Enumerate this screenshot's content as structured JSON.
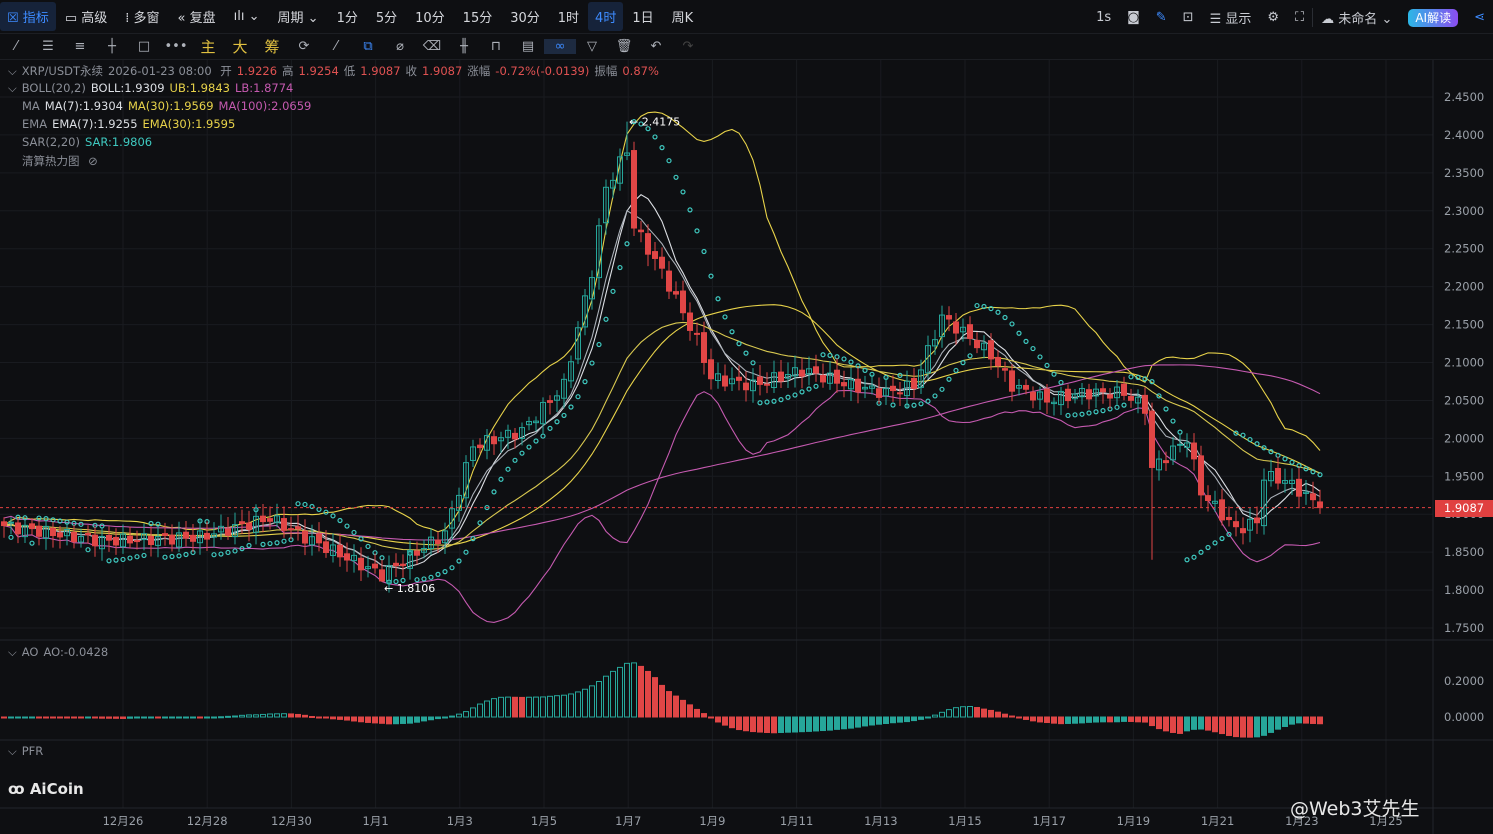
{
  "toolbar": {
    "items": [
      "指标",
      "高级",
      "多窗",
      "复盘",
      "周期",
      "1分",
      "5分",
      "10分",
      "15分",
      "30分",
      "1时",
      "4时",
      "1日",
      "周K"
    ],
    "active": "4时",
    "right": [
      "1s",
      "显示",
      "未命名",
      "AI解读"
    ]
  },
  "drawbar": {
    "labels": [
      "主",
      "大",
      "筹"
    ]
  },
  "legend": {
    "symbol": "XRP/USDT永续",
    "time": "2026-01-23 08:00",
    "open_l": "开",
    "open": "1.9226",
    "high_l": "高",
    "high": "1.9254",
    "low_l": "低",
    "low": "1.9087",
    "close_l": "收",
    "close": "1.9087",
    "chg_l": "涨幅",
    "chg": "-0.72%(-0.0139)",
    "amp_l": "振幅",
    "amp": "0.87%",
    "boll": "BOLL(20,2)",
    "boll_v": "BOLL:1.9309",
    "ub": "UB:1.9843",
    "lb": "LB:1.8774",
    "ma": "MA",
    "ma7": "MA(7):1.9304",
    "ma30": "MA(30):1.9569",
    "ma100": "MA(100):2.0659",
    "ema": "EMA",
    "ema7": "EMA(7):1.9255",
    "ema30": "EMA(30):1.9595",
    "sar": "SAR(2,20)",
    "sar_v": "SAR:1.9806",
    "heat": "清算热力图",
    "ao": "AO",
    "ao_v": "AO:-0.0428",
    "pfr": "PFR"
  },
  "last_price": "1.9087",
  "watermark": "@Web3艾先生",
  "brand": "AiCoin",
  "colors": {
    "up": "#26a69a",
    "down": "#e04646",
    "ma7": "#dcdfe4",
    "ma30": "#e8d34a",
    "ma100": "#c55ab0",
    "sar": "#3fc9c0"
  },
  "chart_data": {
    "type": "candlestick",
    "interval": "4h",
    "yticks": [
      "2.4500",
      "2.4000",
      "2.3500",
      "2.3000",
      "2.2500",
      "2.2000",
      "2.1500",
      "2.1000",
      "2.0500",
      "2.0000",
      "1.9500",
      "1.9000",
      "1.8500",
      "1.8000",
      "1.7500"
    ],
    "ylim": [
      1.75,
      2.45
    ],
    "ao_ticks": [
      "0.2000",
      "0.0000"
    ],
    "xticks": [
      "12月26",
      "12月28",
      "12月30",
      "1月1",
      "1月3",
      "1月5",
      "1月7",
      "1月9",
      "1月11",
      "1月13",
      "1月15",
      "1月17",
      "1月19",
      "1月21",
      "1月23",
      "1月25"
    ],
    "annotations": {
      "high": "2.4175",
      "low": "1.8106"
    },
    "close_anchors": [
      [
        0,
        1.885
      ],
      [
        14,
        1.865
      ],
      [
        28,
        1.87
      ],
      [
        38,
        1.895
      ],
      [
        43,
        1.87
      ],
      [
        54,
        1.82
      ],
      [
        63,
        1.875
      ],
      [
        67,
        1.99
      ],
      [
        74,
        2.01
      ],
      [
        80,
        2.07
      ],
      [
        84,
        2.22
      ],
      [
        86,
        2.33
      ],
      [
        89,
        2.38
      ],
      [
        90,
        2.28
      ],
      [
        94,
        2.22
      ],
      [
        99,
        2.13
      ],
      [
        101,
        2.08
      ],
      [
        107,
        2.07
      ],
      [
        114,
        2.09
      ],
      [
        121,
        2.07
      ],
      [
        126,
        2.06
      ],
      [
        130,
        2.07
      ],
      [
        134,
        2.16
      ],
      [
        137,
        2.14
      ],
      [
        141,
        2.11
      ],
      [
        144,
        2.07
      ],
      [
        149,
        2.05
      ],
      [
        154,
        2.06
      ],
      [
        160,
        2.06
      ],
      [
        163,
        2.04
      ],
      [
        164,
        1.96
      ],
      [
        169,
        2.0
      ],
      [
        171,
        1.93
      ],
      [
        176,
        1.88
      ],
      [
        179,
        1.89
      ],
      [
        180,
        1.95
      ],
      [
        183,
        1.945
      ],
      [
        186,
        1.925
      ],
      [
        188,
        1.9087
      ]
    ]
  }
}
